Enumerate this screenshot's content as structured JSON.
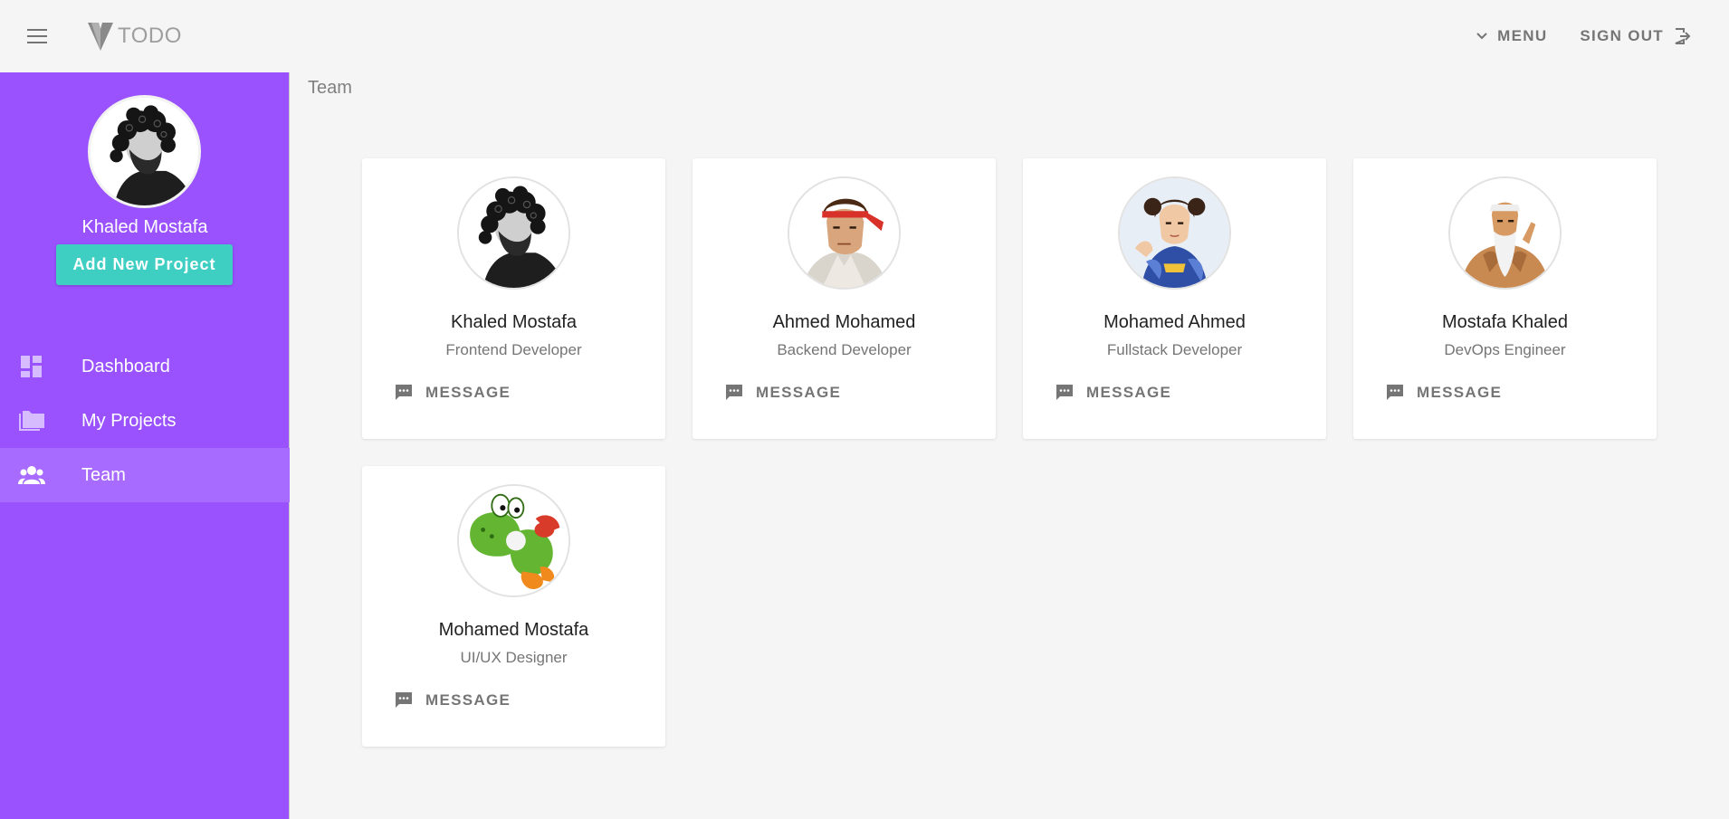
{
  "app": {
    "title": "TODO",
    "logo_icon": "vuetify-logo-icon"
  },
  "topbar": {
    "menu_toggle_icon": "hamburger-icon",
    "menu_label": "MENU",
    "menu_icon": "chevron-down-icon",
    "signout_label": "SIGN OUT",
    "signout_icon": "exit-icon"
  },
  "sidebar": {
    "user_name": "Khaled Mostafa",
    "add_project_label": "Add New Project",
    "accent_color": "#9a52ff",
    "button_color": "#3fcfc2",
    "items": [
      {
        "label": "Dashboard",
        "icon": "dashboard-icon",
        "active": false
      },
      {
        "label": "My Projects",
        "icon": "folder-icon",
        "active": false
      },
      {
        "label": "Team",
        "icon": "people-icon",
        "active": true
      }
    ]
  },
  "page": {
    "breadcrumb": "Team"
  },
  "team": {
    "message_label": "MESSAGE",
    "members": [
      {
        "name": "Khaled Mostafa",
        "role": "Frontend Developer"
      },
      {
        "name": "Ahmed Mohamed",
        "role": "Backend Developer"
      },
      {
        "name": "Mohamed Ahmed",
        "role": "Fullstack Developer"
      },
      {
        "name": "Mostafa Khaled",
        "role": "DevOps Engineer"
      },
      {
        "name": "Mohamed Mostafa",
        "role": "UI/UX Designer"
      }
    ]
  }
}
